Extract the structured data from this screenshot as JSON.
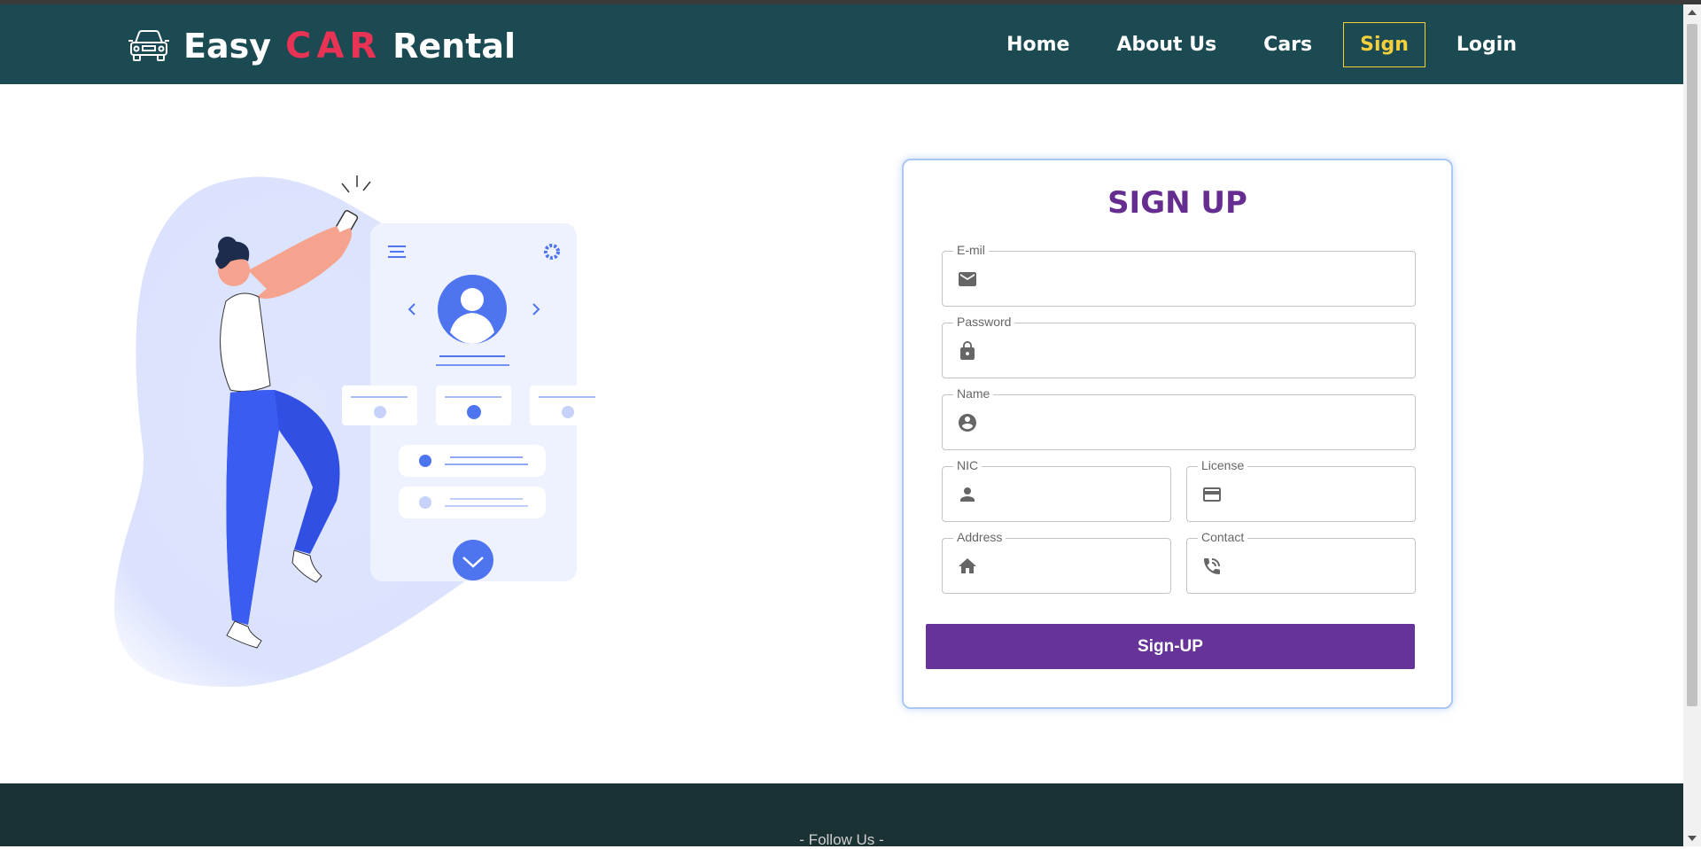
{
  "brand": {
    "word1": "Easy",
    "word2": "CAR",
    "word3": "Rental"
  },
  "nav": {
    "home": "Home",
    "about": "About Us",
    "cars": "Cars",
    "sign": "Sign",
    "login": "Login"
  },
  "form": {
    "title": "SIGN UP",
    "email_label": "E-mil",
    "password_label": "Password",
    "name_label": "Name",
    "nic_label": "NIC",
    "license_label": "License",
    "address_label": "Address",
    "contact_label": "Contact",
    "submit_label": "Sign-UP"
  },
  "footer": {
    "follow": "- Follow Us -"
  },
  "colors": {
    "navbar": "#1b4a53",
    "brand_accent": "#e83355",
    "active_nav": "#f5d03b",
    "primary": "#663399",
    "footer": "#1b3235"
  }
}
